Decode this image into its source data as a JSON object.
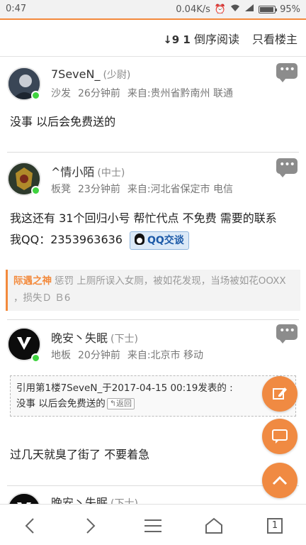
{
  "status_bar": {
    "time": "0:47",
    "network_speed": "0.04K/s",
    "battery": "95%",
    "battery_level": 0.95
  },
  "toolbar": {
    "sort_label": "倒序阅读",
    "only_author_label": "只看楼主",
    "sort_icon_text": "↓9 1"
  },
  "posts": [
    {
      "username": "7SeveN_",
      "rank": "(少尉)",
      "floor": "沙发",
      "time": "26分钟前",
      "location": "来自:贵州省黔南州 联通",
      "content": "没事 以后会免费送的"
    },
    {
      "username": "^情小陌",
      "rank": "(中士)",
      "floor": "板凳",
      "time": "23分钟前",
      "location": "来自:河北省保定市 电信",
      "content_line1": "我这还有 31个回归小号  帮忙代点  不免费  需要的联系",
      "content_line2": "我QQ：2353963636",
      "qq_button": "QQ交谈"
    },
    {
      "username": "晚安丶失眠",
      "rank": "(下士)",
      "floor": "地板",
      "time": "20分钟前",
      "location": "来自:北京市 移动",
      "quote_header": "引用第1楼7SeveN_于2017-04-15 00:19发表的 :",
      "quote_text": "没事 以后会免费送的",
      "quote_back": "返回",
      "content": "过几天就臭了街了  不要着急"
    },
    {
      "username": "晚安丶失眠",
      "rank": "(下士)"
    }
  ],
  "punishment": {
    "who": "际遇之神",
    "text": "惩罚 上厕所误入女厕，被如花发现，当场被如花OOXX ，损失Ｄ Ｂ6"
  },
  "bottom_nav": {
    "page_number": "1"
  },
  "colors": {
    "accent": "#f08a42",
    "online": "#3fd33f"
  }
}
